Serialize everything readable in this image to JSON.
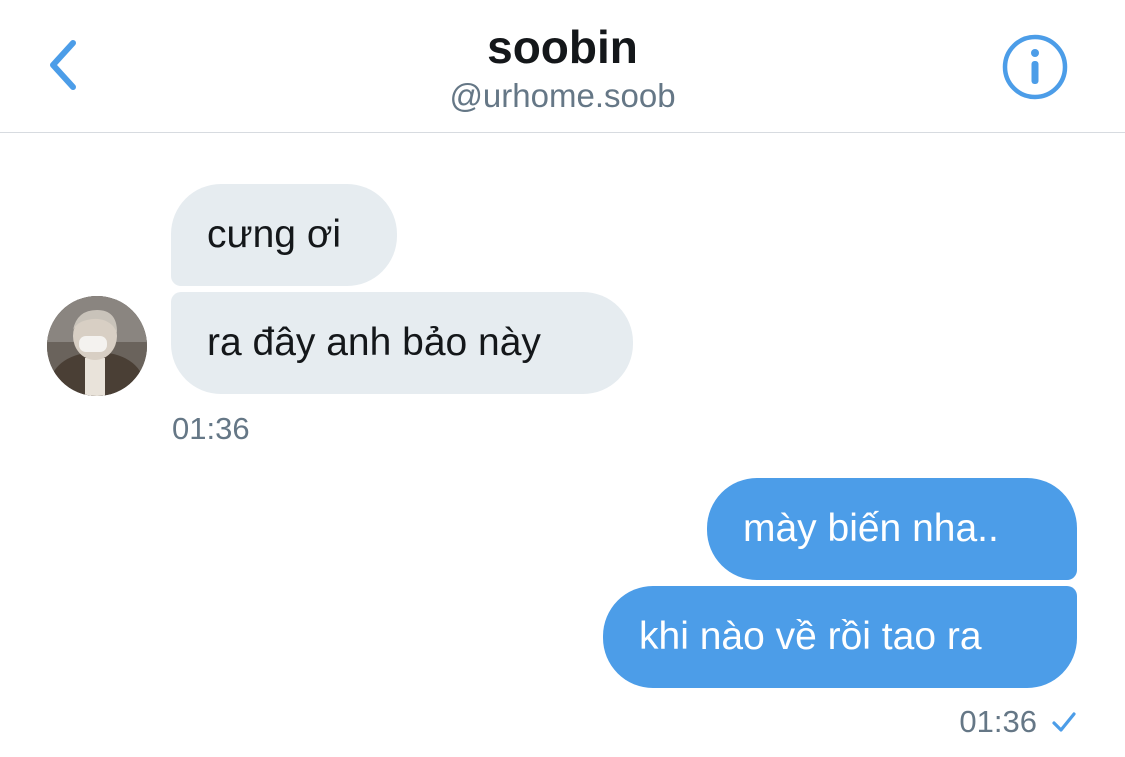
{
  "header": {
    "title": "soobin",
    "handle": "@urhome.soob",
    "icons": {
      "back": "chevron-left-icon",
      "info": "info-circle-icon"
    },
    "accent_color": "#4c9de8"
  },
  "conversation": {
    "incoming": {
      "messages": [
        {
          "text": "cưng ơi"
        },
        {
          "text": "ra đây anh bảo này"
        }
      ],
      "time": "01:36",
      "avatar_icon": "user-avatar"
    },
    "outgoing": {
      "messages": [
        {
          "text": "mày biến nha.."
        },
        {
          "text": "khi nào về rồi tao ra"
        }
      ],
      "time": "01:36",
      "status_icon": "check-icon"
    },
    "colors": {
      "incoming_bubble": "#e6ecf0",
      "outgoing_bubble": "#4c9de8",
      "meta_text": "#657786"
    }
  }
}
